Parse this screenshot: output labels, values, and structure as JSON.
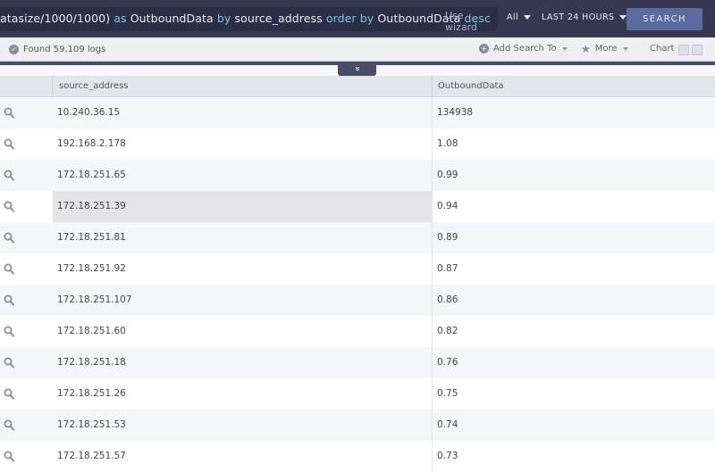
{
  "query": {
    "parts": [
      {
        "text": "atasize/1000/1000)",
        "kw": false
      },
      {
        "text": " as ",
        "kw": true
      },
      {
        "text": "OutboundData",
        "kw": false
      },
      {
        "text": " by ",
        "kw": true
      },
      {
        "text": "source_address",
        "kw": false
      },
      {
        "text": " order by ",
        "kw": true
      },
      {
        "text": "OutboundData",
        "kw": false
      },
      {
        "text": " desc",
        "kw": true
      }
    ],
    "use_wizard": "Use wizard"
  },
  "filters": {
    "scope": "All",
    "time_range": "LAST 24 HOURS"
  },
  "search_button": "SEARCH",
  "toolbar": {
    "found": "Found 59,109 logs",
    "add_search_to": "Add Search To",
    "more": "More",
    "chart": "Chart"
  },
  "collapse_glyph": "»",
  "table": {
    "columns": [
      "source_address",
      "OutboundData"
    ],
    "rows": [
      [
        "10.240.36.15",
        "134938"
      ],
      [
        "192.168.2.178",
        "1.08"
      ],
      [
        "172.18.251.65",
        "0.99"
      ],
      [
        "172.18.251.39",
        "0.94"
      ],
      [
        "172.18.251.81",
        "0.89"
      ],
      [
        "172.18.251.92",
        "0.87"
      ],
      [
        "172.18.251.107",
        "0.86"
      ],
      [
        "172.18.251.60",
        "0.82"
      ],
      [
        "172.18.251.18",
        "0.76"
      ],
      [
        "172.18.251.26",
        "0.75"
      ],
      [
        "172.18.251.53",
        "0.74"
      ],
      [
        "172.18.251.57",
        "0.73"
      ]
    ],
    "highlighted_row": 3
  },
  "colors": {
    "accent": "#5c6aa2",
    "topbar": "#353850",
    "keyword": "#7fc2e8"
  }
}
